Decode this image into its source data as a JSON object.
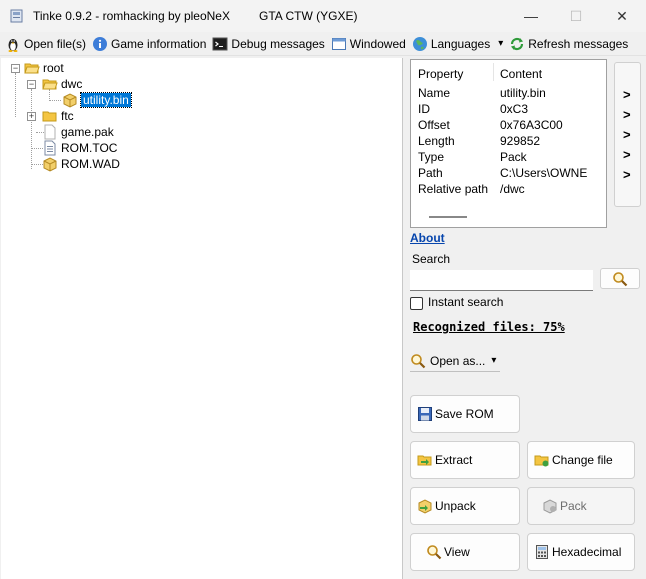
{
  "window": {
    "title": "Tinke 0.9.2 - romhacking by pleoNeX",
    "subtitle": "GTA CTW (YGXE)",
    "minimize": "—",
    "maximize": "☐",
    "close": "✕"
  },
  "toolbar": {
    "open_files": "Open file(s)",
    "game_information": "Game information",
    "debug_messages": "Debug messages",
    "windowed": "Windowed",
    "languages": "Languages",
    "languages_arrow": "▾",
    "refresh_messages": "Refresh messages"
  },
  "tree": {
    "root": "root",
    "dwc": "dwc",
    "utility": "utility.bin",
    "ftc": "ftc",
    "game_pak": "game.pak",
    "rom_toc": "ROM.TOC",
    "rom_wad": "ROM.WAD",
    "minus": "−",
    "plus": "+"
  },
  "properties": {
    "header_property": "Property",
    "header_content": "Content",
    "rows": [
      {
        "key": "Name",
        "value": "utility.bin"
      },
      {
        "key": "ID",
        "value": "0xC3"
      },
      {
        "key": "Offset",
        "value": "0x76A3C00"
      },
      {
        "key": "Length",
        "value": "929852"
      },
      {
        "key": "Type",
        "value": "Pack"
      },
      {
        "key": "Path",
        "value": "C:\\Users\\OWNE"
      },
      {
        "key": "Relative path",
        "value": "/dwc"
      }
    ]
  },
  "side_arrows": [
    ">",
    ">",
    ">",
    ">",
    ">"
  ],
  "panel": {
    "about": "About",
    "search_label": "Search",
    "search_value": "",
    "instant_search": "Instant search",
    "recognized": "Recognized files: 75%",
    "open_as": "Open as...",
    "open_as_arrow": "▾"
  },
  "buttons": {
    "save_rom": "Save ROM",
    "extract": "Extract",
    "change_file": "Change file",
    "unpack": "Unpack",
    "pack": "Pack",
    "view": "View",
    "hexadecimal": "Hexadecimal"
  },
  "colors": {
    "selection": "#0078d7",
    "link": "#0645ad",
    "folder": "#f4c542"
  }
}
